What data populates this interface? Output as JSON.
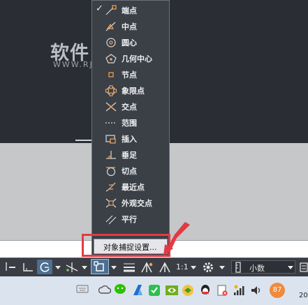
{
  "watermark": {
    "title": "软件自学网",
    "subtitle": "WWW.RJZXW.COM"
  },
  "snap_menu": {
    "items": [
      {
        "label": "端点",
        "checked": true,
        "icon": "endpoint-icon"
      },
      {
        "label": "中点",
        "checked": false,
        "icon": "midpoint-icon"
      },
      {
        "label": "圆心",
        "checked": false,
        "icon": "center-icon"
      },
      {
        "label": "几何中心",
        "checked": false,
        "icon": "geometric-center-icon"
      },
      {
        "label": "节点",
        "checked": false,
        "icon": "node-icon"
      },
      {
        "label": "象限点",
        "checked": false,
        "icon": "quadrant-icon"
      },
      {
        "label": "交点",
        "checked": false,
        "icon": "intersection-icon"
      },
      {
        "label": "范围",
        "checked": false,
        "icon": "extension-icon"
      },
      {
        "label": "插入",
        "checked": false,
        "icon": "insertion-icon"
      },
      {
        "label": "垂足",
        "checked": false,
        "icon": "perpendicular-icon"
      },
      {
        "label": "切点",
        "checked": false,
        "icon": "tangent-icon"
      },
      {
        "label": "最近点",
        "checked": false,
        "icon": "nearest-icon"
      },
      {
        "label": "外观交点",
        "checked": false,
        "icon": "apparent-intersection-icon"
      },
      {
        "label": "平行",
        "checked": false,
        "icon": "parallel-icon"
      }
    ],
    "checkmark": "✓",
    "settings_label": "对象捕捉设置..."
  },
  "statusbar": {
    "scale": "1:1",
    "units": "小数"
  },
  "taskbar": {
    "badge": "87",
    "clock": "20"
  },
  "colors": {
    "menu_bg": "#3b3f46",
    "callout": "#e23b44",
    "icon_accent": "#f0a35a"
  }
}
